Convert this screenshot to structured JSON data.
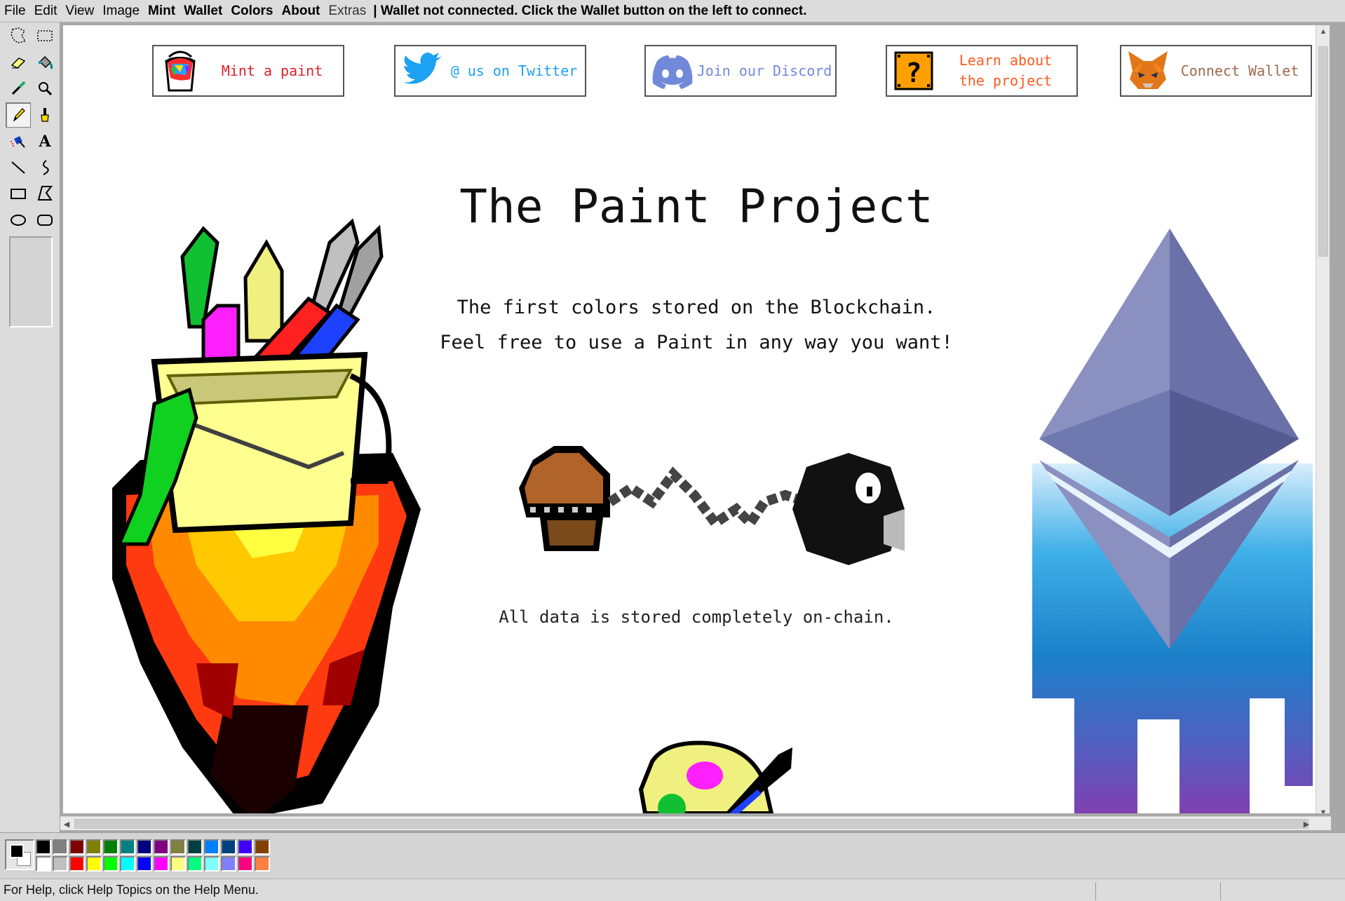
{
  "menubar": {
    "items": [
      "File",
      "Edit",
      "View",
      "Image"
    ],
    "bold_items": [
      "Mint",
      "Wallet",
      "Colors",
      "About"
    ],
    "extras": "Extras",
    "status_message": "| Wallet not connected. Click the Wallet button on the left to connect."
  },
  "toolbox": {
    "tools": [
      "free-select-icon",
      "rect-select-icon",
      "eraser-icon",
      "fill-icon",
      "color-picker-icon",
      "magnifier-icon",
      "pencil-icon",
      "brush-icon",
      "airbrush-icon",
      "text-icon",
      "line-icon",
      "curve-icon",
      "rectangle-icon",
      "polygon-icon",
      "ellipse-icon",
      "rounded-rect-icon"
    ],
    "active_tool": "pencil-icon"
  },
  "nav": {
    "mint": "Mint a paint",
    "twitter": "@ us on Twitter",
    "discord": "Join our Discord",
    "learn_line1": "Learn about",
    "learn_line2": "the project",
    "wallet": "Connect Wallet"
  },
  "colors": {
    "mint_text": "#e0202a",
    "twitter_text": "#1da1f2",
    "discord_text": "#7289da",
    "learn_text": "#ff5a1e",
    "wallet_text": "#a0694a"
  },
  "content": {
    "title": "The Paint Project",
    "tagline1": "The first colors stored on the Blockchain.",
    "tagline2": "Feel free to use a Paint in any way you want!",
    "footnote": "All data is stored completely on-chain."
  },
  "palette": {
    "row1": [
      "#000000",
      "#808080",
      "#800000",
      "#808000",
      "#008000",
      "#008080",
      "#000080",
      "#800080",
      "#808040",
      "#004040",
      "#0080ff",
      "#004080",
      "#4000ff",
      "#804000"
    ],
    "row2": [
      "#ffffff",
      "#c0c0c0",
      "#ff0000",
      "#ffff00",
      "#00ff00",
      "#00ffff",
      "#0000ff",
      "#ff00ff",
      "#ffff80",
      "#00ff80",
      "#80ffff",
      "#8080ff",
      "#ff0080",
      "#ff8040"
    ]
  },
  "statusbar": {
    "help": "For Help, click Help Topics on the Help Menu."
  }
}
